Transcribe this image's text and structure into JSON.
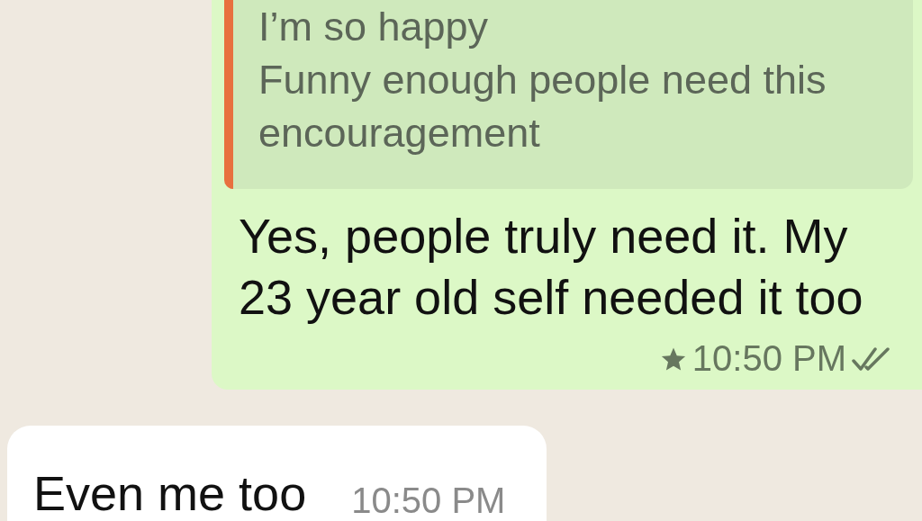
{
  "messages": [
    {
      "kind": "outgoing",
      "quote": {
        "lines": [
          "I’m so happy",
          "Funny enough people need this encouragement"
        ],
        "color": "#e8703f"
      },
      "text": "Yes, people truly need it. My 23 year old self needed it too",
      "time": "10:50 PM",
      "starred": true,
      "read": false
    },
    {
      "kind": "incoming",
      "text": "Even me too",
      "time": "10:50 PM",
      "starred": false
    }
  ]
}
